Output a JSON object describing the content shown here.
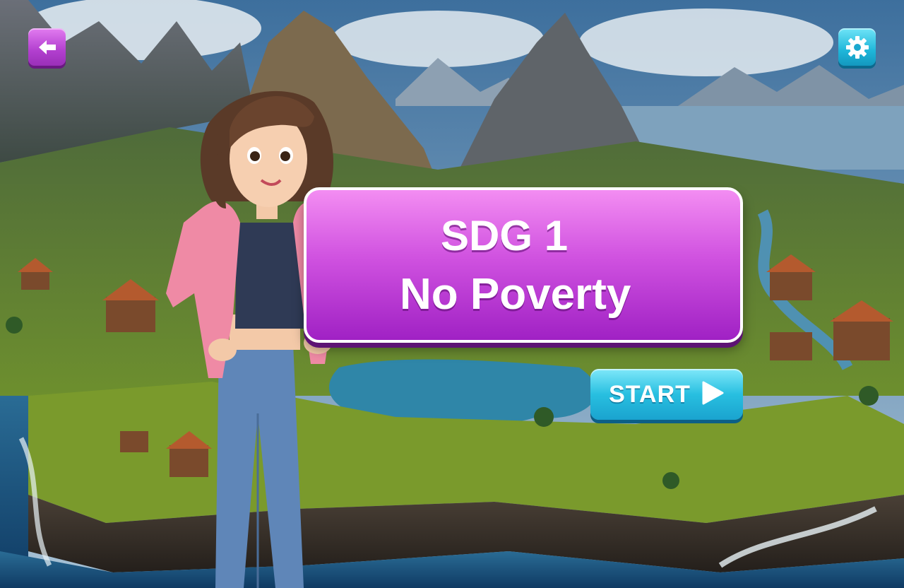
{
  "title": {
    "line1": "SDG 1",
    "line2": "No Poverty"
  },
  "start_button": {
    "label": "START",
    "icon": "play-triangle-icon"
  },
  "top_bar": {
    "back_icon": "back-arrow-icon",
    "settings_icon": "gear-icon"
  },
  "colors": {
    "banner_top": "#f38df2",
    "banner_bottom": "#a021c4",
    "start_top": "#7fe8fa",
    "start_bottom": "#1aa3cf",
    "back_button": "#c04fd6",
    "settings_button": "#1fb6d9"
  }
}
